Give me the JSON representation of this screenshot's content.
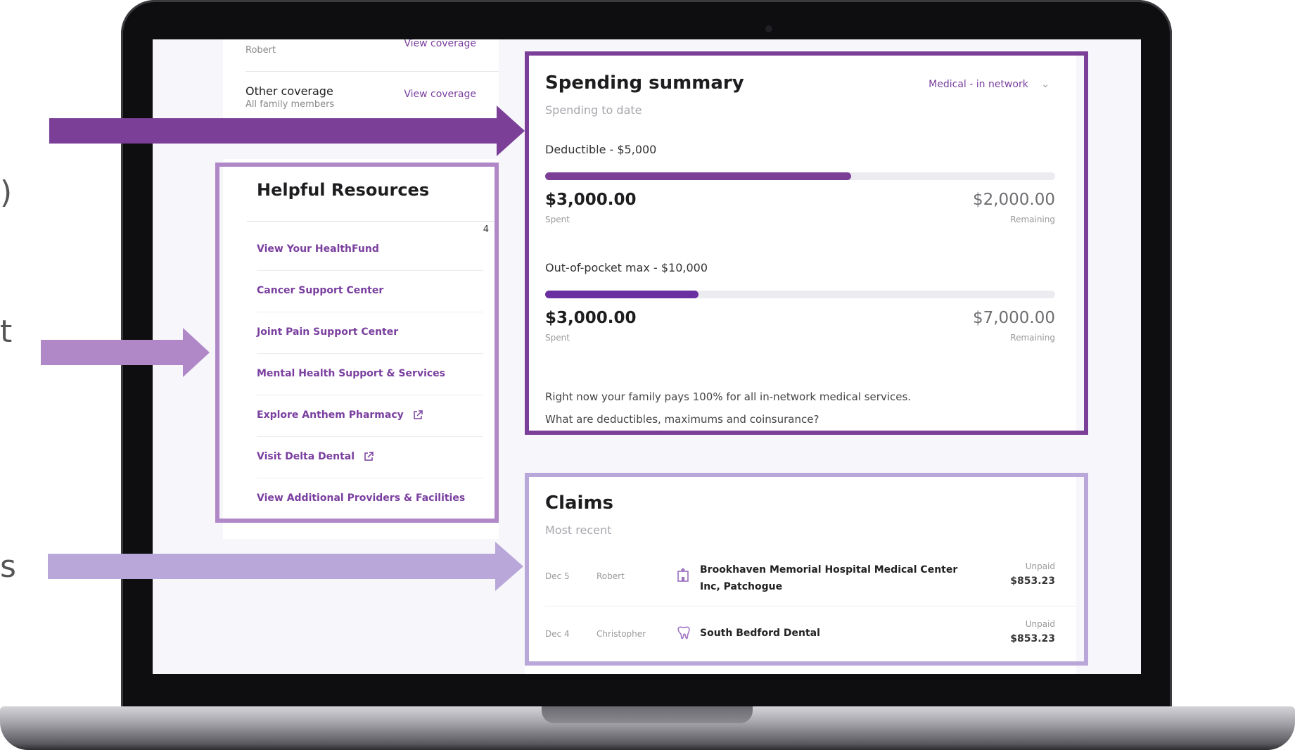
{
  "colors": {
    "brand_purple": "#7b3f98",
    "light_purple": "#b8a7d8",
    "mid_purple": "#b088c7",
    "link_purple": "#7a3f9f"
  },
  "edge_glyphs": [
    ")",
    "t",
    "s"
  ],
  "coverage": {
    "partial_member": "Robert",
    "partial_link": "View coverage",
    "other": {
      "name": "Other coverage",
      "sub": "All family members",
      "link": "View coverage"
    }
  },
  "resources": {
    "title": "Helpful Resources",
    "count": "4",
    "items": [
      {
        "label": "View Your HealthFund",
        "external": false
      },
      {
        "label": "Cancer Support Center",
        "external": false
      },
      {
        "label": "Joint Pain Support Center",
        "external": false
      },
      {
        "label": "Mental Health Support & Services",
        "external": false
      },
      {
        "label": "Explore Anthem Pharmacy",
        "external": true,
        "icon": "external-link-icon"
      },
      {
        "label": "Visit Delta Dental",
        "external": true,
        "icon": "external-link-icon"
      },
      {
        "label": "View Additional Providers & Facilities",
        "external": false
      }
    ]
  },
  "spending": {
    "title": "Spending summary",
    "subtitle": "Spending to date",
    "filter": "Medical - in network",
    "filter_icon": "chevron-down-icon",
    "meters": [
      {
        "label": "Deductible - $5,000",
        "spent": "$3,000.00",
        "spent_caption": "Spent",
        "remaining": "$2,000.00",
        "remaining_caption": "Remaining",
        "progress": 0.6,
        "color": "#7b3f98"
      },
      {
        "label": "Out-of-pocket max - $10,000",
        "spent": "$3,000.00",
        "spent_caption": "Spent",
        "remaining": "$7,000.00",
        "remaining_caption": "Remaining",
        "progress": 0.3,
        "color": "#6a2fa0"
      }
    ],
    "note": "Right now your family pays 100% for all in-network medical services.",
    "link": "What are deductibles, maximums and coinsurance?"
  },
  "claims": {
    "title": "Claims",
    "subtitle": "Most recent",
    "rows": [
      {
        "date": "Dec 5",
        "member": "Robert",
        "icon": "hospital-icon",
        "provider": "Brookhaven Memorial Hospital Medical Center Inc, Patchogue",
        "status": "Unpaid",
        "amount": "$853.23"
      },
      {
        "date": "Dec 4",
        "member": "Christopher",
        "icon": "tooth-icon",
        "provider": "South Bedford Dental",
        "status": "Unpaid",
        "amount": "$853.23"
      }
    ]
  }
}
